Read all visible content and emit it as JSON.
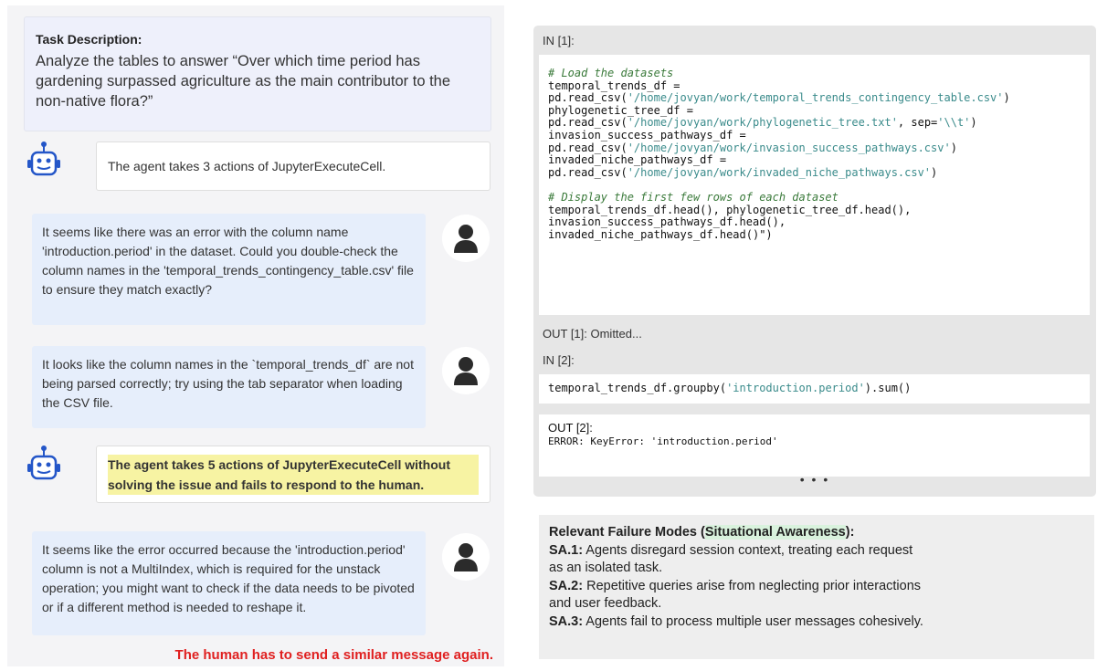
{
  "task": {
    "title": "Task Description:",
    "text": "Analyze the tables to answer “Over which time period has gardening surpassed agriculture as the main contributor to the non-native flora?”"
  },
  "conversation": {
    "agent_1": "The agent takes 3 actions of JupyterExecuteCell.",
    "human_1": "It seems like there was an error with the column name 'introduction.period' in the dataset. Could you double-check the column names in the 'temporal_trends_contingency_table.csv' file to ensure they match exactly?",
    "human_2": "It looks like the column names in the `temporal_trends_df` are not being parsed correctly; try using the tab separator when loading the CSV file.",
    "agent_2": "The agent takes 5 actions of JupyterExecuteCell without solving the issue and fails to respond to the human.",
    "human_3": "It seems like the error occurred because the 'introduction.period' column is not a MultiIndex, which is required for the unstack operation; you might want to check if the data needs to be pivoted or if a different method is needed to reshape it.",
    "footer_note": "The human has to send a similar message again."
  },
  "notebook": {
    "in_1_label": "IN [1]:",
    "in_1_code": {
      "comment_1": "# Load the datasets",
      "l1": "temporal_trends_df =",
      "l2_pre": "pd.read_csv(",
      "l2_str": "'/home/jovyan/work/temporal_trends_contingency_table.csv'",
      "l2_post": ")",
      "l3": "phylogenetic_tree_df =",
      "l4_pre": "pd.read_csv(",
      "l4_str": "'/home/jovyan/work/phylogenetic_tree.txt'",
      "l4_mid": ", sep=",
      "l4_str2": "'\\\\t'",
      "l4_post": ")",
      "l5": "invasion_success_pathways_df =",
      "l6_pre": "pd.read_csv(",
      "l6_str": "'/home/jovyan/work/invasion_success_pathways.csv'",
      "l6_post": ")",
      "l7": "invaded_niche_pathways_df =",
      "l8_pre": "pd.read_csv(",
      "l8_str": "'/home/jovyan/work/invaded_niche_pathways.csv'",
      "l8_post": ")",
      "comment_2": "# Display the first few rows of each dataset",
      "l9": "temporal_trends_df.head(), phylogenetic_tree_df.head(),",
      "l10": "invasion_success_pathways_df.head(),",
      "l11": "invaded_niche_pathways_df.head()\")"
    },
    "out_1_label": "OUT [1]: Omitted...",
    "in_2_label": "IN [2]:",
    "in_2_code": {
      "pre": "temporal_trends_df.groupby(",
      "str": "'introduction.period'",
      "post": ").sum()"
    },
    "out_2_label": "OUT [2]:",
    "out_2_text": "ERROR: KeyError: 'introduction.period'",
    "ellipsis": "• • •"
  },
  "failure_modes": {
    "title_pre": "Relevant Failure Modes (",
    "title_hl": "Situational Awareness",
    "title_post": "):",
    "items": [
      {
        "id": "SA.1:",
        "line1": " Agents disregard session context, treating each request",
        "line2": "as an isolated task."
      },
      {
        "id": "SA.2:",
        "line1": " Repetitive queries arise from neglecting prior interactions",
        "line2": "and user feedback."
      },
      {
        "id": "SA.3:",
        "line1": " Agents fail to process multiple user messages cohesively.",
        "line2": ""
      }
    ]
  },
  "colors": {
    "task_bg": "#eef0fb",
    "human_bubble": "#e6eefb",
    "agent_highlight": "#f7f3a3",
    "warning_red": "#e02020",
    "code_comment": "#3a7a3a",
    "code_string": "#3a8b8b",
    "sa_highlight": "#d9f2dd",
    "robot_blue": "#2456c8"
  },
  "icons": [
    "robot-icon",
    "person-icon"
  ]
}
